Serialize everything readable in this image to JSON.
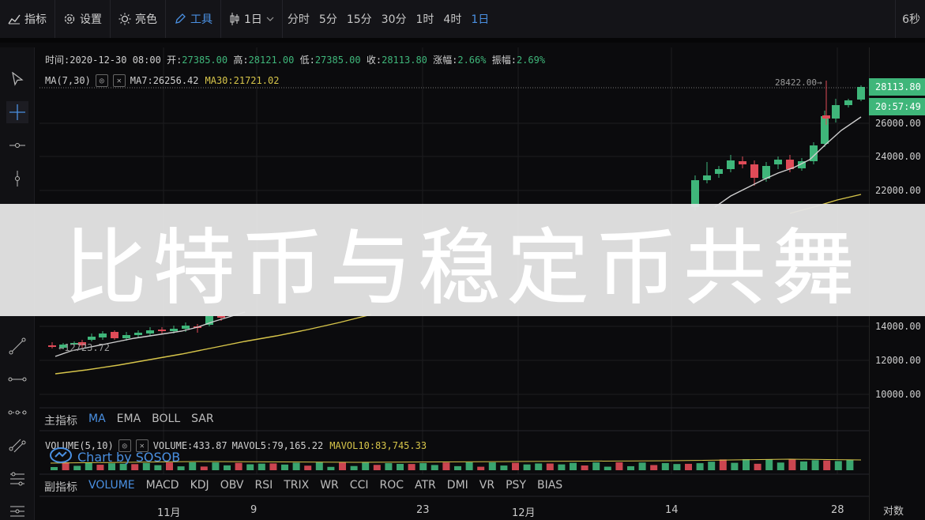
{
  "toolbar": {
    "indicators_label": "指标",
    "settings_label": "设置",
    "theme_label": "亮色",
    "tools_label": "工具",
    "interval_label": "1日",
    "periods": [
      "分时",
      "5分",
      "15分",
      "30分",
      "1时",
      "4时",
      "1日"
    ],
    "active_period": "1日",
    "refresh_label": "6秒"
  },
  "ohlc": {
    "time_label": "时间:",
    "time_value": "2020-12-30 08:00",
    "open_label": "开:",
    "open_value": "27385.00",
    "high_label": "高:",
    "high_value": "28121.00",
    "low_label": "低:",
    "low_value": "27385.00",
    "close_label": "收:",
    "close_value": "28113.80",
    "change_label": "涨幅:",
    "change_value": "2.66%",
    "amplitude_label": "振幅:",
    "amplitude_value": "2.69%"
  },
  "ma": {
    "name": "MA(7,30)",
    "ma7_label": "MA7:",
    "ma7_value": "26256.42",
    "ma30_label": "MA30:",
    "ma30_value": "21721.02"
  },
  "chart_annotations": {
    "high_marker": "28422.00→",
    "low_marker": "←12723.72"
  },
  "price_axis": {
    "ticks": [
      "26000.00",
      "24000.00",
      "22000.00",
      "14000.00",
      "12000.00",
      "10000.00"
    ],
    "current_price": "28113.80",
    "countdown": "20:57:49",
    "scale_label": "对数"
  },
  "main_indicators": {
    "label": "主指标",
    "items": [
      "MA",
      "EMA",
      "BOLL",
      "SAR"
    ],
    "active": "MA"
  },
  "volume": {
    "name": "VOLUME(5,10)",
    "volume_label": "VOLUME:",
    "volume_value": "433.87",
    "mavol5_label": "MAVOL5:",
    "mavol5_value": "79,165.22",
    "mavol10_label": "MAVOL10:",
    "mavol10_value": "83,745.33"
  },
  "sub_indicators": {
    "label": "副指标",
    "items": [
      "VOLUME",
      "MACD",
      "KDJ",
      "OBV",
      "RSI",
      "TRIX",
      "WR",
      "CCI",
      "ROC",
      "ATR",
      "DMI",
      "VR",
      "PSY",
      "BIAS"
    ],
    "active": "VOLUME"
  },
  "time_axis": [
    "11月",
    "9",
    "23",
    "12月",
    "14",
    "28"
  ],
  "watermark": "Chart by SOSOB",
  "banner": "比特币与稳定币共舞",
  "colors": {
    "up": "#3fb67a",
    "down": "#e04b58",
    "accent": "#4a90e2",
    "ma30": "#d7c54a",
    "ma7": "#cfcfcf"
  }
}
